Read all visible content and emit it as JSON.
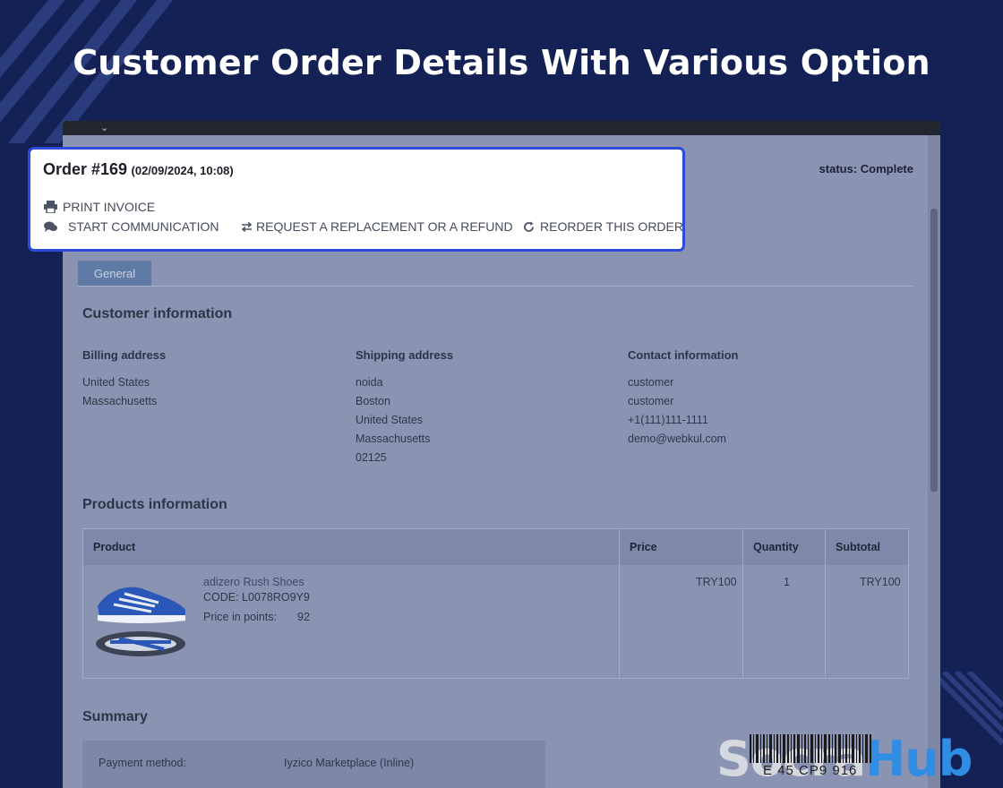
{
  "headline": "Customer Order Details With Various Option",
  "order": {
    "number": "Order #169",
    "date": "(02/09/2024, 10:08)",
    "status": "status: Complete"
  },
  "actions": {
    "print": {
      "label": "PRINT INVOICE",
      "icon": "printer-icon"
    },
    "communication": {
      "label": "START COMMUNICATION",
      "icon": "chat-bubbles-icon"
    },
    "refund": {
      "label": "REQUEST A REPLACEMENT OR A REFUND",
      "icon": "exchange-arrows-icon"
    },
    "reorder": {
      "label": "REORDER THIS ORDER",
      "icon": "refresh-icon"
    }
  },
  "tabs": [
    {
      "label": "General",
      "active": true
    }
  ],
  "customer": {
    "title": "Customer information",
    "billing": {
      "title": "Billing address",
      "lines": [
        "United States",
        "Massachusetts"
      ]
    },
    "shipping": {
      "title": "Shipping address",
      "lines": [
        "noida",
        "Boston",
        "United States",
        "Massachusetts",
        "02125"
      ]
    },
    "contact": {
      "title": "Contact information",
      "lines": [
        "customer",
        "customer",
        "+1(111)111-1111",
        "demo@webkul.com"
      ]
    }
  },
  "products": {
    "title": "Products information",
    "columns": [
      "Product",
      "Price",
      "Quantity",
      "Subtotal"
    ],
    "rows": [
      {
        "name": "adizero Rush Shoes",
        "code": "CODE: L0078RO9Y9",
        "points_label": "Price in points:",
        "points_value": "92",
        "price": "TRY100",
        "quantity": "1",
        "subtotal": "TRY100"
      }
    ]
  },
  "summary": {
    "title": "Summary",
    "payment_label": "Payment method:",
    "payment_value": "Iyzico Marketplace (Inline)"
  },
  "logo": {
    "part1": "Socra",
    "part2": "Hub",
    "barcode_text": "E 45 CP9 916"
  },
  "colors": {
    "background": "#142155",
    "highlight": "#2f4bdc",
    "brand_blue": "#2f8de4"
  }
}
